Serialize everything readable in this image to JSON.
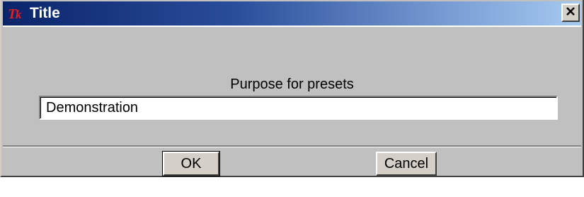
{
  "window": {
    "title": "Title"
  },
  "dialog": {
    "prompt_label": "Purpose for presets",
    "entry_value": "Demonstration"
  },
  "buttons": {
    "ok_label": "OK",
    "cancel_label": "Cancel"
  },
  "icons": {
    "app_icon": "tk-feather-icon",
    "close_icon": "close-icon"
  },
  "colors": {
    "titlebar_start": "#0a246a",
    "titlebar_end": "#a6caf0",
    "dialog_bg": "#c0c0c0",
    "tk_icon_red": "#e02020"
  }
}
